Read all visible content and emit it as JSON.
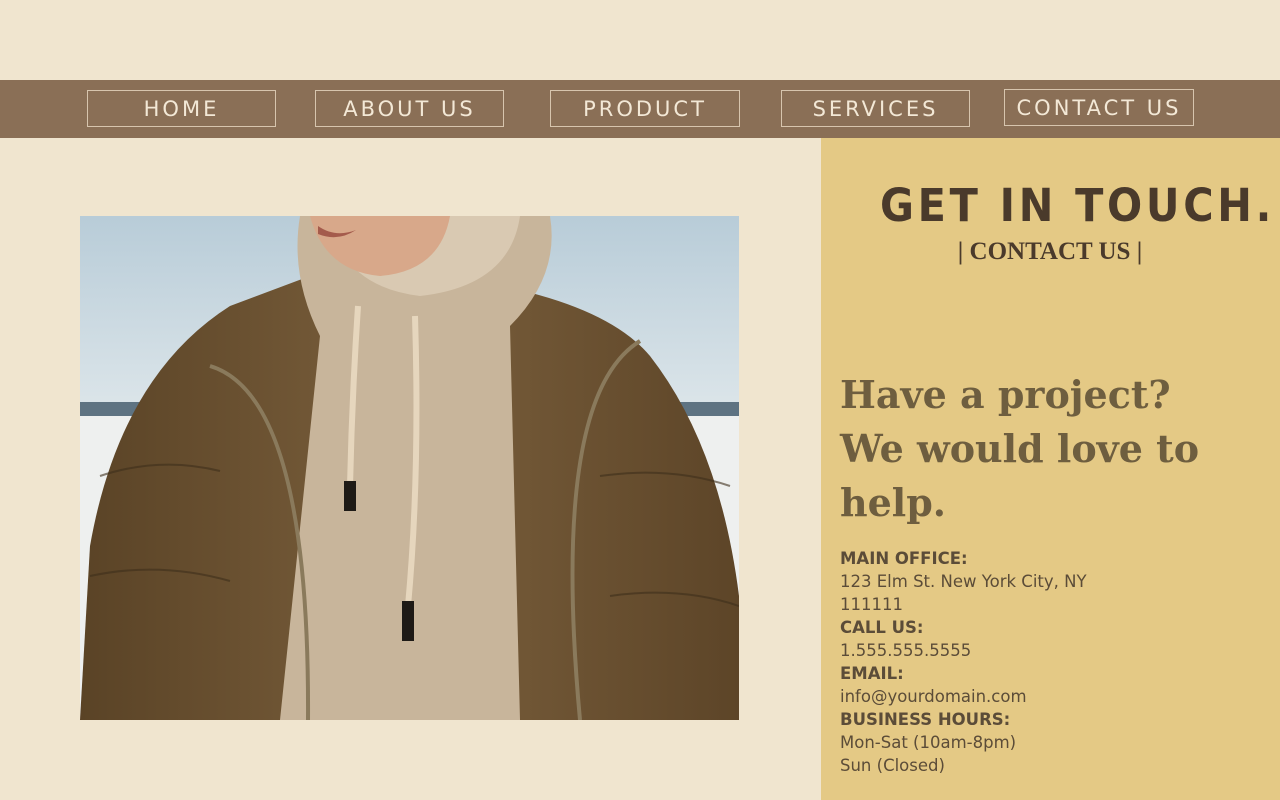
{
  "nav": {
    "items": [
      {
        "label": "HOME"
      },
      {
        "label": "ABOUT US"
      },
      {
        "label": "PRODUCT"
      },
      {
        "label": "SERVICES"
      },
      {
        "label": "CONTACT US"
      }
    ]
  },
  "hero": {
    "image_subject": "person wearing brown puffer jacket over beige hoodie by the sea"
  },
  "contact": {
    "title": "GET IN TOUCH.",
    "subtitle": "| CONTACT US |",
    "headline_line1": "Have a project?",
    "headline_line2": "We would love to",
    "headline_line3": "help.",
    "main_office_label": "MAIN OFFICE:",
    "main_office_line1": "123 Elm St. New York City, NY",
    "main_office_line2": "111111",
    "call_label": "CALL US:",
    "call_value": "1.555.555.5555",
    "email_label": "EMAIL:",
    "email_value": "info@yourdomain.com",
    "hours_label": "BUSINESS HOURS:",
    "hours_line1": "Mon-Sat (10am-8pm)",
    "hours_line2": "Sun (Closed)"
  },
  "colors": {
    "page_bg": "#f0e5cf",
    "nav_bg": "#8a6f56",
    "panel_bg": "#e4c985",
    "title_text": "#4a3a2b",
    "headline_text": "#6e5e3f"
  }
}
